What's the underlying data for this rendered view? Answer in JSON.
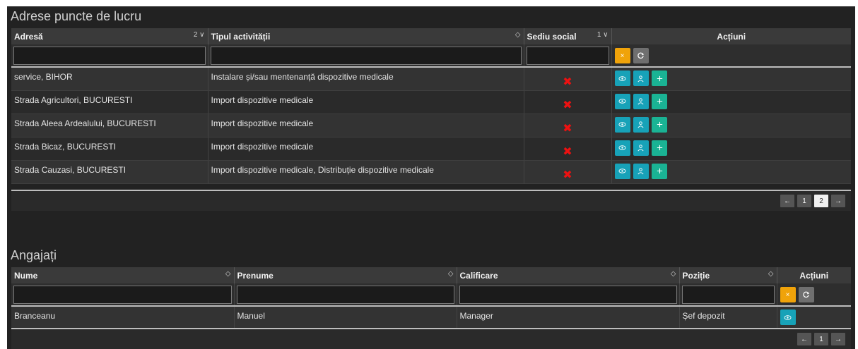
{
  "workplaces": {
    "title": "Adrese puncte de lucru",
    "columns": [
      {
        "label": "Adresă",
        "sort": "2 ∨"
      },
      {
        "label": "Tipul activității",
        "sort": "◇"
      },
      {
        "label": "Sediu social",
        "sort": "1 ∨"
      },
      {
        "label": "Acțiuni",
        "sort": ""
      }
    ],
    "rows": [
      {
        "address": "service, BIHOR",
        "activity": "Instalare și/sau mentenanță dispozitive medicale",
        "headquarters": "✖"
      },
      {
        "address": "Strada Agricultori, BUCURESTI",
        "activity": "Import dispozitive medicale",
        "headquarters": "✖"
      },
      {
        "address": "Strada Aleea Ardealului, BUCURESTI",
        "activity": "Import dispozitive medicale",
        "headquarters": "✖"
      },
      {
        "address": "Strada Bicaz, BUCURESTI",
        "activity": "Import dispozitive medicale",
        "headquarters": "✖"
      },
      {
        "address": "Strada Cauzasi, BUCURESTI",
        "activity": "Import dispozitive medicale, Distribuție dispozitive medicale",
        "headquarters": "✖"
      }
    ],
    "pagination": {
      "prev": "←",
      "pages": [
        "1",
        "2"
      ],
      "current": "2",
      "next": "→"
    }
  },
  "employees": {
    "title": "Angajați",
    "columns": [
      {
        "label": "Nume",
        "sort": "◇"
      },
      {
        "label": "Prenume",
        "sort": "◇"
      },
      {
        "label": "Calificare",
        "sort": "◇"
      },
      {
        "label": "Poziție",
        "sort": "◇"
      },
      {
        "label": "Acțiuni",
        "sort": ""
      }
    ],
    "rows": [
      {
        "last_name": "Branceanu",
        "first_name": "Manuel",
        "qualification": "Manager",
        "position": "Șef depozit"
      }
    ],
    "pagination": {
      "prev": "←",
      "pages": [
        "1"
      ],
      "current": "1",
      "next": "→"
    }
  },
  "buttons": {
    "clear": "×"
  },
  "colors": {
    "headquarters_no": "#ee1111",
    "clear": "#f0a30a",
    "view": "#17a2b8",
    "add": "#1ab394"
  },
  "icons": {
    "view": "eye-icon",
    "user": "user-icon",
    "add": "plus-icon",
    "reset": "refresh-icon"
  }
}
